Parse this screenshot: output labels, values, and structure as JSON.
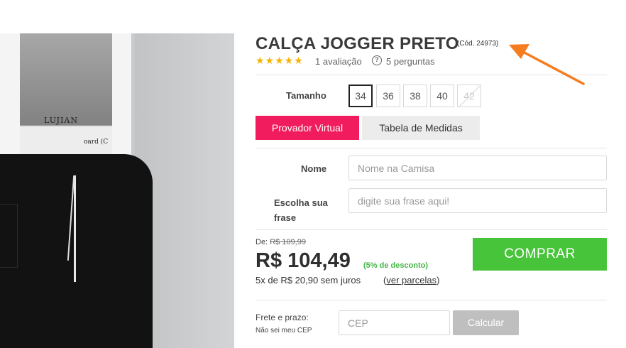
{
  "product": {
    "title": "CALÇA JOGGER PRETO",
    "code": "(Cód. 24973)",
    "stars": "★★★★★",
    "reviews": "1 avaliação",
    "questions": "5 perguntas",
    "question_icon_glyph": "?"
  },
  "image": {
    "print_text": "LUJIAN",
    "print_text2": "oard (C"
  },
  "size": {
    "label": "Tamanho",
    "options": [
      "34",
      "36",
      "38",
      "40",
      "42"
    ],
    "selected": "34",
    "unavailable": [
      "42"
    ]
  },
  "buttons": {
    "provador": "Provador Virtual",
    "tabela": "Tabela de Medidas",
    "comprar": "COMPRAR",
    "calcular": "Calcular"
  },
  "fields": {
    "nome_label": "Nome",
    "nome_placeholder": "Nome na Camisa",
    "frase_label_1": "Escolha sua",
    "frase_label_2": "frase",
    "frase_placeholder": "digite sua frase aqui!"
  },
  "pricing": {
    "de_label": "De:",
    "old_price": "R$ 109,99",
    "price": "R$ 104,49",
    "discount": "(5% de desconto)",
    "installments": "5x de R$ 20,90 sem juros",
    "parcelas_open": "(",
    "parcelas_link": "ver parcelas",
    "parcelas_close": ")"
  },
  "shipping": {
    "label": "Frete e prazo:",
    "sub": "Não sei meu CEP",
    "cep_placeholder": "CEP"
  },
  "colors": {
    "provador": "#f01c5d",
    "comprar": "#47c43a",
    "stars": "#f5b301",
    "discount": "#45b649",
    "arrow": "#f57c1f"
  }
}
